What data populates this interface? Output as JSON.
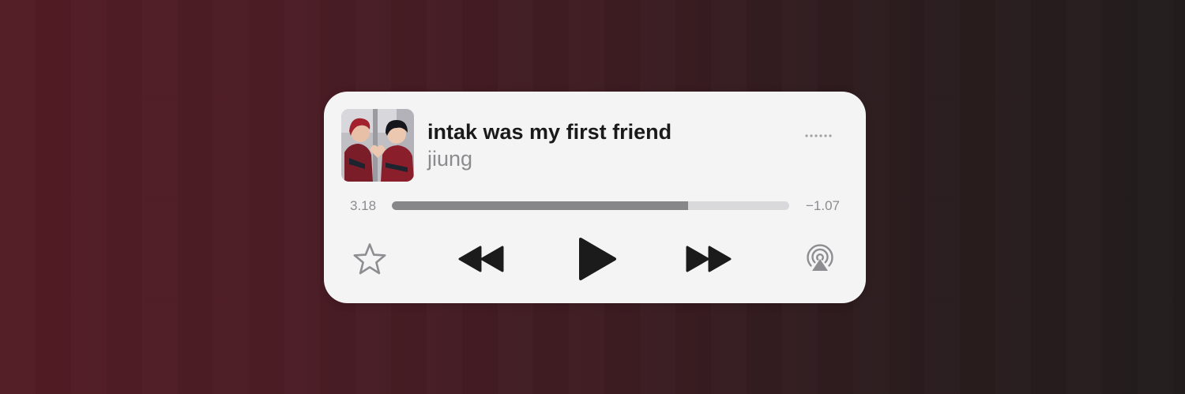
{
  "player": {
    "title": "intak was my first friend",
    "artist": "jiung",
    "elapsed": "3.18",
    "remaining": "−1.07",
    "progress_fraction": 0.746
  },
  "icons": {
    "more": "more-icon",
    "favorite": "star-icon",
    "rewind": "rewind-icon",
    "play": "play-icon",
    "fast_forward": "fast-forward-icon",
    "airplay": "airplay-icon"
  },
  "colors": {
    "background_left": "#531c24",
    "background_right": "#221c1d",
    "card": "#f4f4f4",
    "title": "#1a1a1a",
    "artist": "#8b8b8f",
    "progress_fill": "#878789",
    "progress_track": "#d9d9dc",
    "controls": "#1b1b1b"
  }
}
